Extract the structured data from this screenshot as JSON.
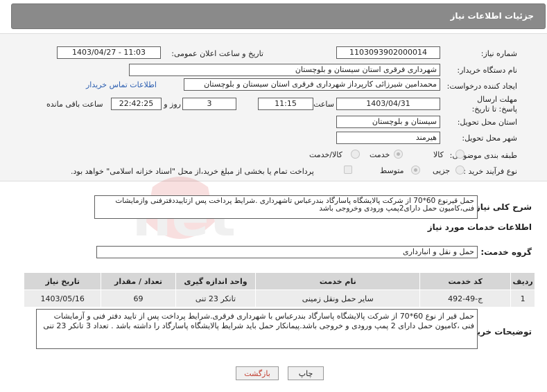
{
  "header": {
    "title": "جزئیات اطلاعات نیاز"
  },
  "fields": {
    "need_number_label": "شماره نیاز:",
    "need_number": "1103093902000014",
    "announce_label": "تاریخ و ساعت اعلان عمومی:",
    "announce_value": "1403/04/27 - 11:03",
    "buyer_org_label": "نام دستگاه خریدار:",
    "buyer_org": "شهرداری فرقری استان سیستان و بلوچستان",
    "creator_label": "ایجاد کننده درخواست:",
    "creator": "محمدامین شیرزائی کارپرداز شهرداری فرقری استان سیستان و بلوچستان",
    "contact_link": "اطلاعات تماس خریدار",
    "deadline_label": "مهلت ارسال پاسخ: تا تاریخ:",
    "deadline_date": "1403/04/31",
    "time_label": "ساعت",
    "deadline_time": "11:15",
    "days_value": "3",
    "days_label": "روز و",
    "remaining_time": "22:42:25",
    "remaining_label": "ساعت باقی مانده",
    "province_label": "استان محل تحویل:",
    "province": "سیستان و بلوچستان",
    "city_label": "شهر محل تحویل:",
    "city": "هیرمند",
    "category_label": "طبقه بندی موضوعی:",
    "category_options": [
      "کالا",
      "خدمت",
      "کالا/خدمت"
    ],
    "process_label": "نوع فرآیند خرید :",
    "process_options": [
      "جزیی",
      "متوسط"
    ],
    "payment_note": "پرداخت تمام یا بخشی از مبلغ خرید،از محل \"اسناد خزانه اسلامی\" خواهد بود."
  },
  "summary": {
    "label": "شرح کلی نیاز:",
    "text": "حمل قیرنوع 60*70 از شرکت پالایشگاه پاسارگاد بندرعباس تاشهرداری .شرایط پرداخت پس ازتاییددفترفنی وازمایشات فنی،کامیون حمل دارای2پمپ ورودی وخروجی باشد"
  },
  "services": {
    "section_title": "اطلاعات خدمات مورد نیاز",
    "group_label": "گروه خدمت:",
    "group_value": "حمل و نقل و انبارداری",
    "columns": [
      "ردیف",
      "کد خدمت",
      "نام خدمت",
      "واحد اندازه گیری",
      "تعداد / مقدار",
      "تاریخ نیاز"
    ],
    "rows": [
      [
        "1",
        "ج-49-492",
        "سایر حمل ونقل زمینی",
        "تانکر 23 تنی",
        "69",
        "1403/05/16"
      ]
    ]
  },
  "buyer_desc": {
    "label": "توضیحات خریدار:",
    "text": "حمل قیر از نوع 60*70 از شرکت پالایشگاه پاسارگاد بندرعباس با شهرداری فرقری.شرایط پرداخت پس از تایید دفتر فنی و آزمایشات فنی ،کامیون حمل دارای 2 پمپ ورودی و خروجی باشد.پیمانکار حمل باید شرایط پالایشگاه پاسارگاد را داشته باشد . تعداد 3 تانکر 23 تنی"
  },
  "buttons": {
    "print": "چاپ",
    "back": "بازگشت"
  },
  "colors": {
    "header_bg": "#8a8a8a",
    "back_button_text": "#c0392b",
    "link": "#2a5db0"
  }
}
